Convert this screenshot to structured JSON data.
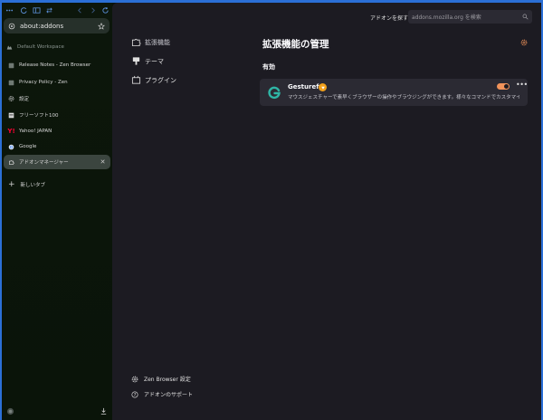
{
  "browser": {
    "url": "about:addons",
    "workspace": "Default Workspace",
    "tabs": [
      {
        "label": "Release Notes - Zen Browser",
        "icon": "zen-favicon"
      },
      {
        "label": "Privacy Policy - Zen",
        "icon": "zen-favicon"
      },
      {
        "label": "設定",
        "icon": "gear-icon"
      },
      {
        "label": "フリーソフト100",
        "icon": "page-favicon"
      },
      {
        "label": "Yahoo! JAPAN",
        "icon": "yahoo-favicon"
      },
      {
        "label": "Google",
        "icon": "google-favicon"
      },
      {
        "label": "アドオンマネージャー",
        "icon": "puzzle-icon",
        "active": true
      }
    ],
    "new_tab": "新しいタブ"
  },
  "addons": {
    "search_label": "アドオンを探す",
    "search_placeholder": "addons.mozilla.org を検索",
    "categories": [
      {
        "label": "拡張機能",
        "icon": "puzzle-icon",
        "selected": true
      },
      {
        "label": "テーマ",
        "icon": "brush-icon"
      },
      {
        "label": "プラグイン",
        "icon": "plugin-icon"
      }
    ],
    "title": "拡張機能の管理",
    "section_enabled": "有効",
    "extension": {
      "name": "Gesturefy",
      "description": "マウスジェスチャーで素早くブラウザーの操作やブラウジングができます。様々なコマンドでカスタマイズ可能な...",
      "enabled": true
    },
    "footer": {
      "settings": "Zen Browser 設定",
      "support": "アドオンのサポート"
    }
  },
  "colors": {
    "accent": "#f1935a",
    "sidebar_bg": "#0a1409",
    "content_bg": "#1c1b22",
    "card_bg": "#2b2a33",
    "frame": "#2b6fd6"
  }
}
